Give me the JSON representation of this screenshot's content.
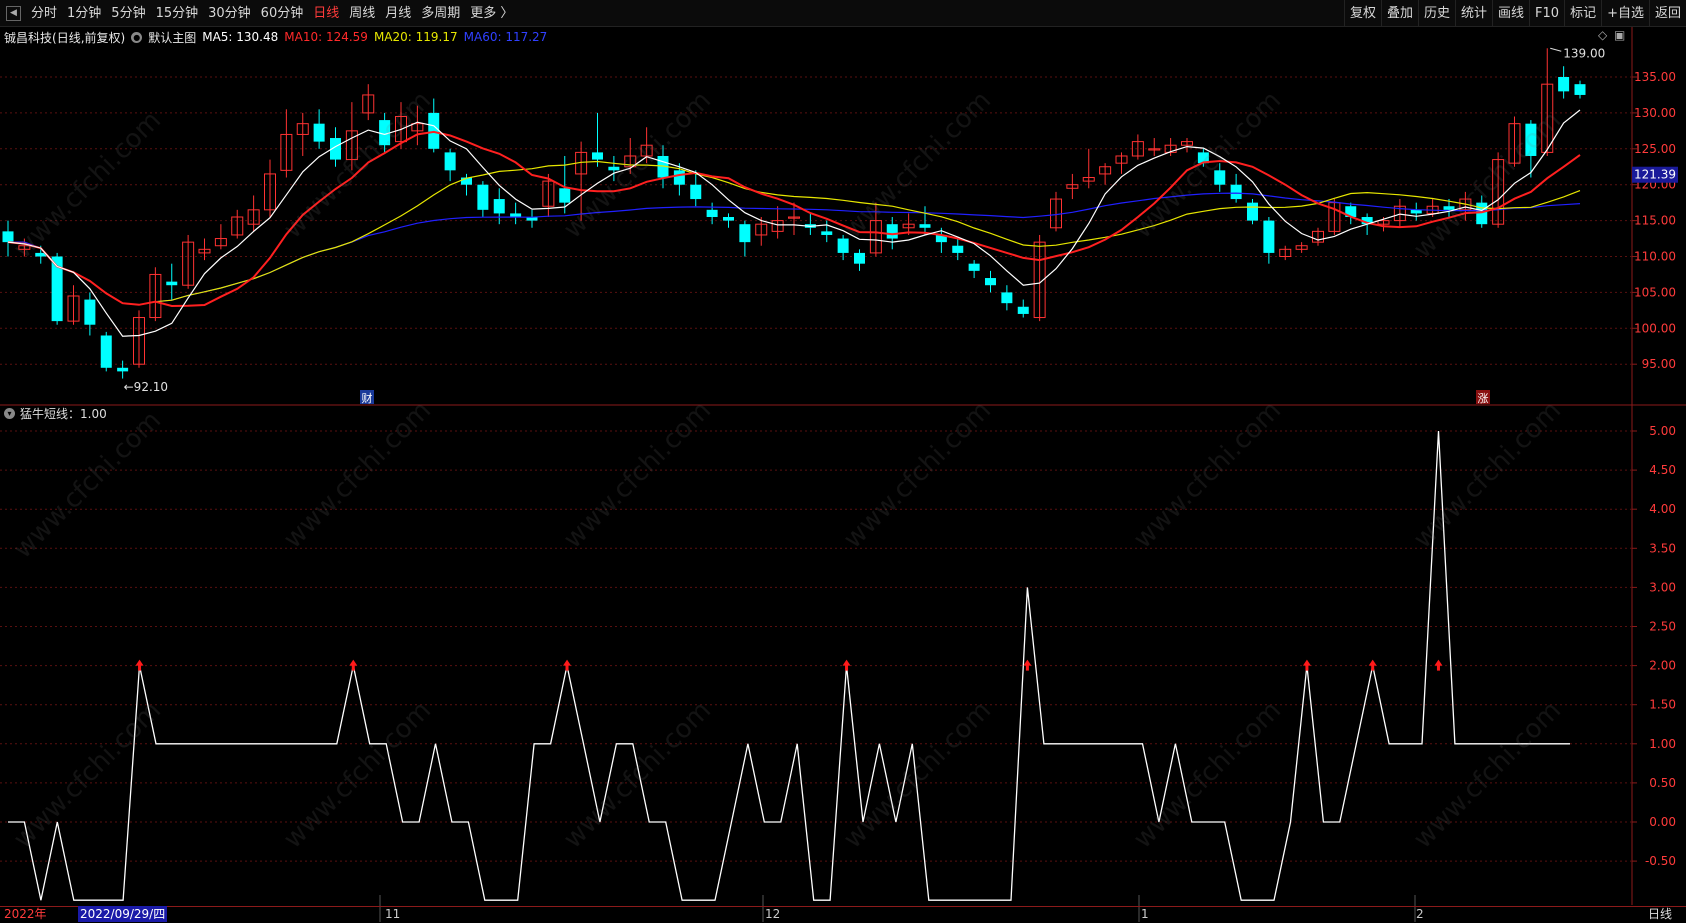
{
  "toolbar": {
    "back_icon": "back-arrow-icon",
    "periods": [
      "分时",
      "1分钟",
      "5分钟",
      "15分钟",
      "30分钟",
      "60分钟",
      "日线",
      "周线",
      "月线",
      "多周期",
      "更多 〉"
    ],
    "active_period": "日线",
    "tools": [
      "复权",
      "叠加",
      "历史",
      "统计",
      "画线",
      "F10",
      "标记",
      "+自选",
      "返回"
    ]
  },
  "main_chart": {
    "stock_name": "铖昌科技",
    "period_note": "(日线,前复权)",
    "template": "默认主图",
    "ma5": {
      "label": "MA5: 130.48",
      "color": "#ffffff"
    },
    "ma10": {
      "label": "MA10: 124.59",
      "color": "#ff2020"
    },
    "ma20": {
      "label": "MA20: 119.17",
      "color": "#e6e600"
    },
    "ma60": {
      "label": "MA60: 117.27",
      "color": "#2020ff"
    },
    "high_marker": "139.00",
    "low_marker": "92.10",
    "current_price": "121.39",
    "y_ticks": [
      "135.00",
      "130.00",
      "125.00",
      "120.00",
      "115.00",
      "110.00",
      "105.00",
      "100.00",
      "95.00"
    ],
    "marker_cai": "财",
    "marker_zhang": "涨",
    "up_color": "#ff3232",
    "down_color": "#00ffff",
    "candles": [
      [
        113.5,
        112.0,
        115.0,
        110.0
      ],
      [
        111.0,
        111.5,
        112.5,
        110.0
      ],
      [
        110.5,
        110.0,
        111.5,
        109.0
      ],
      [
        110.0,
        101.0,
        110.5,
        100.5
      ],
      [
        101.0,
        104.5,
        106.0,
        100.5
      ],
      [
        104.0,
        100.5,
        105.0,
        99.0
      ],
      [
        99.0,
        94.5,
        99.5,
        94.0
      ],
      [
        94.5,
        94.0,
        95.5,
        93.0
      ],
      [
        95.0,
        101.5,
        102.5,
        94.5
      ],
      [
        101.5,
        107.5,
        108.5,
        101.0
      ],
      [
        106.5,
        106.0,
        109.0,
        104.0
      ],
      [
        106.0,
        112.0,
        113.0,
        105.5
      ],
      [
        110.5,
        111.0,
        112.5,
        109.5
      ],
      [
        111.5,
        112.5,
        114.5,
        111.0
      ],
      [
        113.0,
        115.5,
        116.5,
        112.5
      ],
      [
        114.5,
        116.5,
        118.5,
        113.5
      ],
      [
        116.5,
        121.5,
        123.5,
        115.5
      ],
      [
        122.0,
        127.0,
        130.5,
        121.0
      ],
      [
        127.0,
        128.5,
        130.0,
        124.0
      ],
      [
        128.5,
        126.0,
        130.5,
        125.0
      ],
      [
        126.5,
        123.5,
        128.0,
        122.5
      ],
      [
        123.5,
        127.5,
        131.5,
        122.0
      ],
      [
        130.0,
        132.5,
        134.0,
        129.0
      ],
      [
        129.0,
        125.5,
        130.0,
        124.5
      ],
      [
        126.0,
        129.5,
        131.5,
        125.0
      ],
      [
        127.5,
        128.5,
        131.0,
        125.5
      ],
      [
        130.0,
        125.0,
        132.0,
        124.5
      ],
      [
        124.5,
        122.0,
        125.0,
        120.5
      ],
      [
        121.0,
        120.0,
        121.5,
        118.5
      ],
      [
        120.0,
        116.5,
        120.5,
        115.5
      ],
      [
        118.0,
        116.0,
        119.5,
        114.5
      ],
      [
        116.0,
        115.5,
        117.5,
        114.5
      ],
      [
        115.5,
        115.0,
        116.5,
        114.0
      ],
      [
        117.0,
        120.5,
        121.5,
        115.5
      ],
      [
        119.5,
        117.5,
        124.0,
        116.0
      ],
      [
        121.5,
        124.5,
        126.0,
        115.0
      ],
      [
        124.5,
        123.5,
        130.0,
        122.5
      ],
      [
        122.5,
        122.0,
        124.0,
        120.5
      ],
      [
        122.5,
        124.0,
        126.5,
        121.5
      ],
      [
        124.0,
        125.5,
        128.0,
        123.0
      ],
      [
        124.0,
        121.0,
        125.5,
        119.5
      ],
      [
        122.0,
        120.0,
        123.0,
        118.5
      ],
      [
        120.0,
        118.0,
        122.0,
        117.0
      ],
      [
        116.5,
        115.5,
        117.5,
        114.5
      ],
      [
        115.5,
        115.0,
        116.0,
        114.0
      ],
      [
        114.5,
        112.0,
        115.0,
        110.0
      ],
      [
        113.0,
        114.5,
        115.5,
        111.5
      ],
      [
        113.5,
        115.0,
        117.0,
        112.5
      ],
      [
        115.5,
        115.5,
        117.5,
        113.0
      ],
      [
        114.5,
        114.0,
        116.0,
        113.0
      ],
      [
        113.5,
        113.0,
        115.0,
        112.0
      ],
      [
        112.5,
        110.5,
        113.0,
        109.5
      ],
      [
        110.5,
        109.0,
        111.0,
        108.0
      ],
      [
        110.5,
        115.0,
        117.5,
        110.0
      ],
      [
        114.5,
        112.5,
        115.5,
        111.0
      ],
      [
        114.0,
        114.5,
        116.0,
        113.0
      ],
      [
        114.5,
        114.0,
        117.0,
        113.0
      ],
      [
        113.0,
        112.0,
        114.0,
        110.5
      ],
      [
        111.5,
        110.5,
        112.5,
        109.5
      ],
      [
        109.0,
        108.0,
        109.5,
        107.0
      ],
      [
        107.0,
        106.0,
        108.0,
        105.0
      ],
      [
        105.0,
        103.5,
        106.0,
        102.5
      ],
      [
        103.0,
        102.0,
        104.0,
        101.5
      ],
      [
        101.5,
        112.0,
        113.0,
        101.0
      ],
      [
        114.0,
        118.0,
        119.0,
        113.5
      ],
      [
        119.5,
        120.0,
        121.5,
        118.0
      ],
      [
        120.5,
        121.0,
        125.0,
        119.5
      ],
      [
        121.5,
        122.5,
        123.0,
        120.0
      ],
      [
        123.0,
        124.0,
        124.5,
        121.5
      ],
      [
        124.0,
        126.0,
        127.0,
        123.5
      ],
      [
        125.0,
        125.0,
        126.5,
        124.0
      ],
      [
        124.5,
        125.5,
        126.5,
        124.0
      ],
      [
        125.5,
        126.0,
        126.5,
        124.5
      ],
      [
        124.5,
        123.0,
        125.0,
        122.5
      ],
      [
        122.0,
        120.0,
        123.0,
        119.0
      ],
      [
        120.0,
        118.0,
        121.5,
        117.5
      ],
      [
        117.5,
        115.0,
        118.0,
        114.5
      ],
      [
        115.0,
        110.5,
        115.5,
        109.0
      ],
      [
        110.0,
        111.0,
        111.5,
        109.5
      ],
      [
        111.0,
        111.5,
        112.0,
        110.5
      ],
      [
        112.0,
        113.5,
        114.0,
        111.5
      ],
      [
        113.5,
        117.5,
        118.0,
        113.0
      ],
      [
        117.0,
        115.5,
        117.5,
        114.5
      ],
      [
        115.5,
        114.5,
        116.0,
        113.0
      ],
      [
        114.5,
        115.0,
        115.5,
        113.5
      ],
      [
        115.0,
        117.0,
        118.0,
        114.0
      ],
      [
        116.5,
        116.0,
        117.5,
        115.0
      ],
      [
        116.0,
        117.0,
        118.0,
        115.5
      ],
      [
        117.0,
        116.5,
        118.0,
        115.5
      ],
      [
        116.5,
        118.0,
        119.0,
        115.0
      ],
      [
        117.5,
        114.5,
        118.5,
        114.0
      ],
      [
        114.5,
        123.5,
        124.5,
        114.0
      ],
      [
        123.0,
        128.5,
        129.5,
        122.5
      ],
      [
        128.5,
        124.0,
        129.0,
        121.0
      ],
      [
        124.5,
        134.0,
        139.0,
        124.0
      ],
      [
        135.0,
        133.0,
        136.5,
        132.0
      ],
      [
        134.0,
        132.5,
        134.5,
        132.0
      ]
    ]
  },
  "indicator": {
    "label": "猛牛短线：1.00",
    "y_ticks": [
      "5.00",
      "4.50",
      "4.00",
      "3.50",
      "3.00",
      "2.50",
      "2.00",
      "1.50",
      "1.00",
      "0.50",
      "0.00",
      "-0.50"
    ],
    "values": [
      0,
      0,
      -1,
      0,
      -1,
      -1,
      -1,
      -1,
      2,
      1,
      1,
      1,
      1,
      1,
      1,
      1,
      1,
      1,
      1,
      1,
      1,
      2,
      1,
      1,
      0,
      0,
      1,
      0,
      0,
      -1,
      -1,
      -1,
      1,
      1,
      2,
      1,
      0,
      1,
      1,
      0,
      0,
      -1,
      -1,
      -1,
      0,
      1,
      0,
      0,
      1,
      -1,
      -1,
      2,
      0,
      1,
      0,
      1,
      -1,
      -1,
      -1,
      -1,
      -1,
      -1,
      3,
      1,
      1,
      1,
      1,
      1,
      1,
      1,
      0,
      1,
      0,
      0,
      0,
      -1,
      -1,
      -1,
      0,
      2,
      0,
      0,
      1,
      2,
      1,
      1,
      1,
      5,
      1,
      1,
      1,
      1,
      1,
      1,
      1,
      1
    ],
    "signal_indices": [
      8,
      21,
      34,
      51,
      62,
      79,
      83,
      87
    ],
    "line_color": "#ffffff",
    "signal_color": "#ff1a1a"
  },
  "axis": {
    "year_label": "2022年",
    "cursor_date": "2022/09/29/四",
    "month_labels": [
      "11",
      "12",
      "1",
      "2"
    ],
    "period_label": "日线"
  },
  "watermark": "www.cfchi.com"
}
